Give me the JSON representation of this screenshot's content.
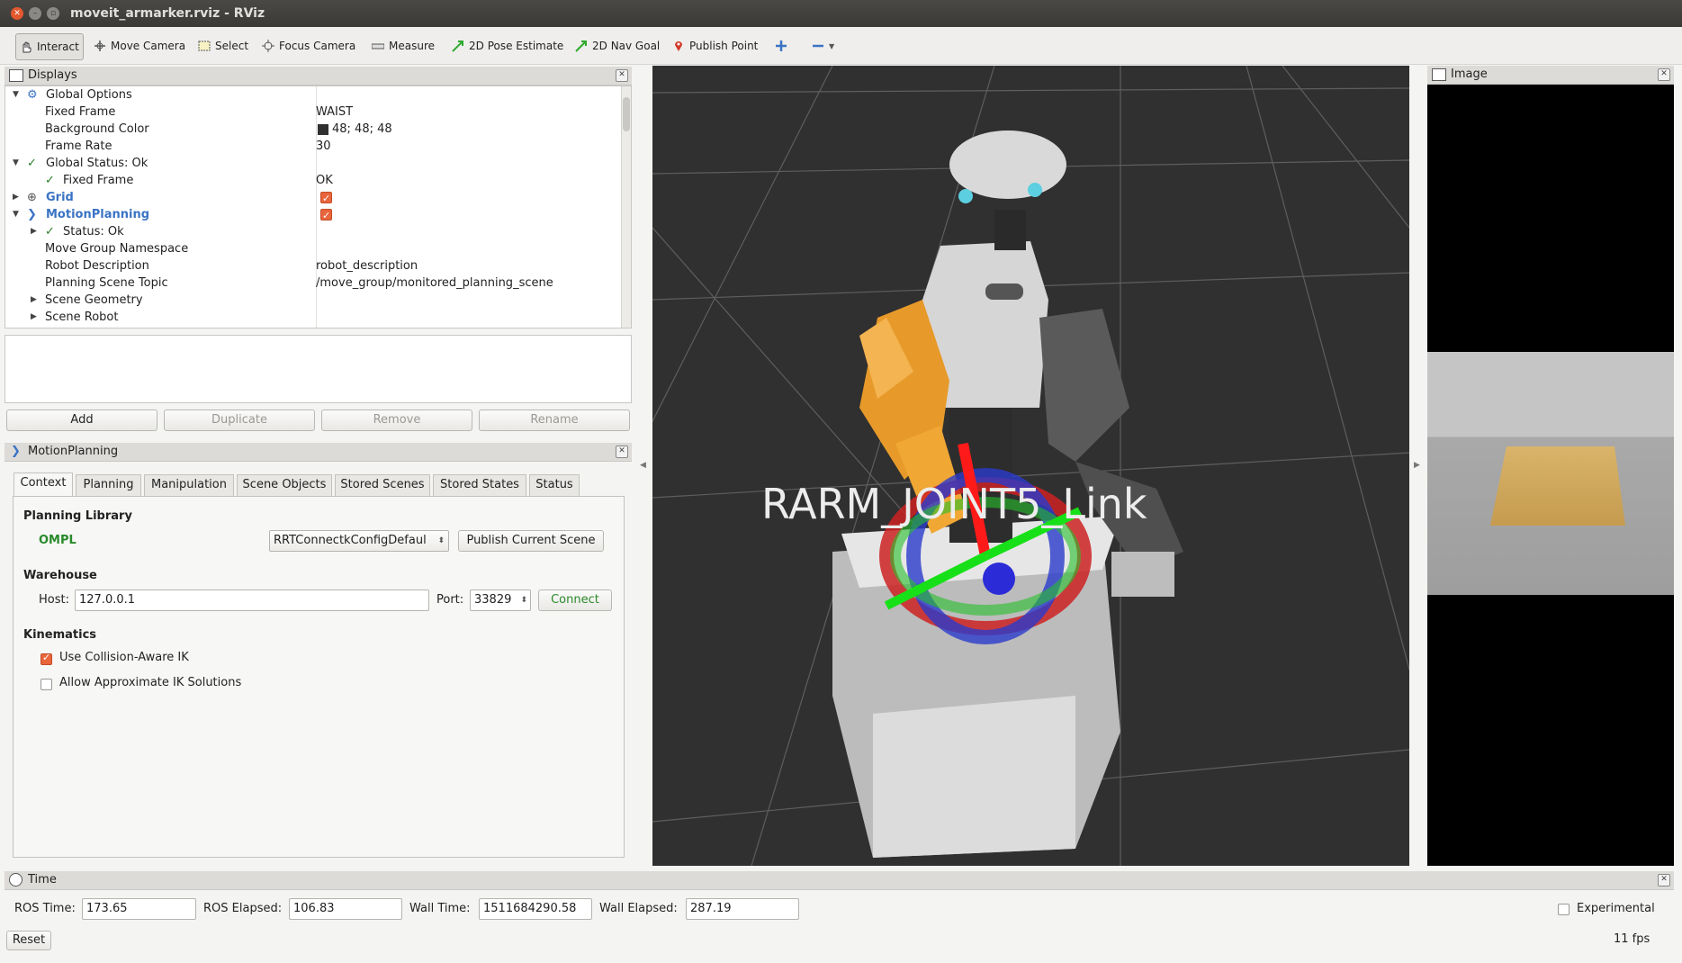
{
  "window": {
    "title": "moveit_armarker.rviz - RViz"
  },
  "toolbar": {
    "interact": "Interact",
    "move_camera": "Move Camera",
    "select": "Select",
    "focus_camera": "Focus Camera",
    "measure": "Measure",
    "pose_estimate": "2D Pose Estimate",
    "nav_goal": "2D Nav Goal",
    "publish_point": "Publish Point"
  },
  "displays": {
    "title": "Displays",
    "rows": [
      {
        "label": "Global Options",
        "value": ""
      },
      {
        "label": "Fixed Frame",
        "value": "WAIST"
      },
      {
        "label": "Background Color",
        "value": "48; 48; 48"
      },
      {
        "label": "Frame Rate",
        "value": "30"
      },
      {
        "label": "Global Status: Ok",
        "value": ""
      },
      {
        "label": "Fixed Frame",
        "value": "OK"
      },
      {
        "label": "Grid",
        "value": ""
      },
      {
        "label": "MotionPlanning",
        "value": ""
      },
      {
        "label": "Status: Ok",
        "value": ""
      },
      {
        "label": "Move Group Namespace",
        "value": ""
      },
      {
        "label": "Robot Description",
        "value": "robot_description"
      },
      {
        "label": "Planning Scene Topic",
        "value": "/move_group/monitored_planning_scene"
      },
      {
        "label": "Scene Geometry",
        "value": ""
      },
      {
        "label": "Scene Robot",
        "value": ""
      }
    ],
    "buttons": {
      "add": "Add",
      "duplicate": "Duplicate",
      "remove": "Remove",
      "rename": "Rename"
    }
  },
  "motion_planning": {
    "title": "MotionPlanning",
    "tabs": [
      "Context",
      "Planning",
      "Manipulation",
      "Scene Objects",
      "Stored Scenes",
      "Stored States",
      "Status"
    ],
    "planning_library_label": "Planning Library",
    "planning_library_value": "OMPL",
    "planner_select": "RRTConnectkConfigDefaul",
    "publish_scene_button": "Publish Current Scene",
    "warehouse_label": "Warehouse",
    "host_label": "Host:",
    "host_value": "127.0.0.1",
    "port_label": "Port:",
    "port_value": "33829",
    "connect_button": "Connect",
    "kinematics_label": "Kinematics",
    "collision_ik_label": "Use Collision-Aware IK",
    "collision_ik_checked": true,
    "approx_ik_label": "Allow Approximate IK Solutions",
    "approx_ik_checked": false
  },
  "viewport": {
    "marker_label": "RARM_JOINT5_Link",
    "background": "#303030"
  },
  "image_panel": {
    "title": "Image"
  },
  "time": {
    "title": "Time",
    "ros_time_label": "ROS Time:",
    "ros_time": "173.65",
    "ros_elapsed_label": "ROS Elapsed:",
    "ros_elapsed": "106.83",
    "wall_time_label": "Wall Time:",
    "wall_time": "1511684290.58",
    "wall_elapsed_label": "Wall Elapsed:",
    "wall_elapsed": "287.19",
    "experimental_label": "Experimental",
    "reset_button": "Reset",
    "fps": "11 fps"
  }
}
